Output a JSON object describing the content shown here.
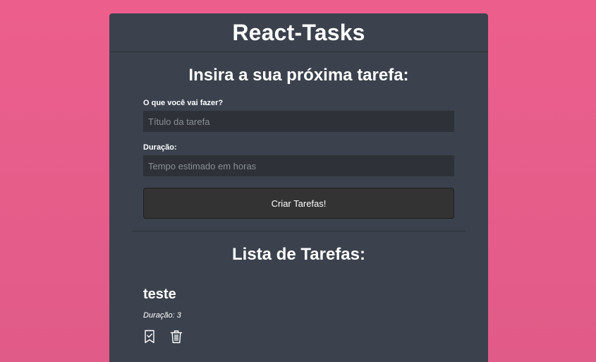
{
  "header": {
    "title": "React-Tasks"
  },
  "form": {
    "title": "Insira a sua próxima tarefa:",
    "task_label": "O que você vai fazer?",
    "task_placeholder": "Título da tarefa",
    "task_value": "",
    "duration_label": "Duração:",
    "duration_placeholder": "Tempo estimado em horas",
    "duration_value": "",
    "submit_label": "Criar Tarefas!"
  },
  "list": {
    "title": "Lista de Tarefas:",
    "tasks": [
      {
        "title": "teste",
        "duration": "Duração: 3",
        "icons": [
          "bookmark-check-icon",
          "trash-icon"
        ]
      }
    ]
  },
  "colors": {
    "background": "#ec5f8d",
    "panel": "#3b424d",
    "input": "#2e3238",
    "button": "#333333",
    "text": "#ffffff"
  }
}
